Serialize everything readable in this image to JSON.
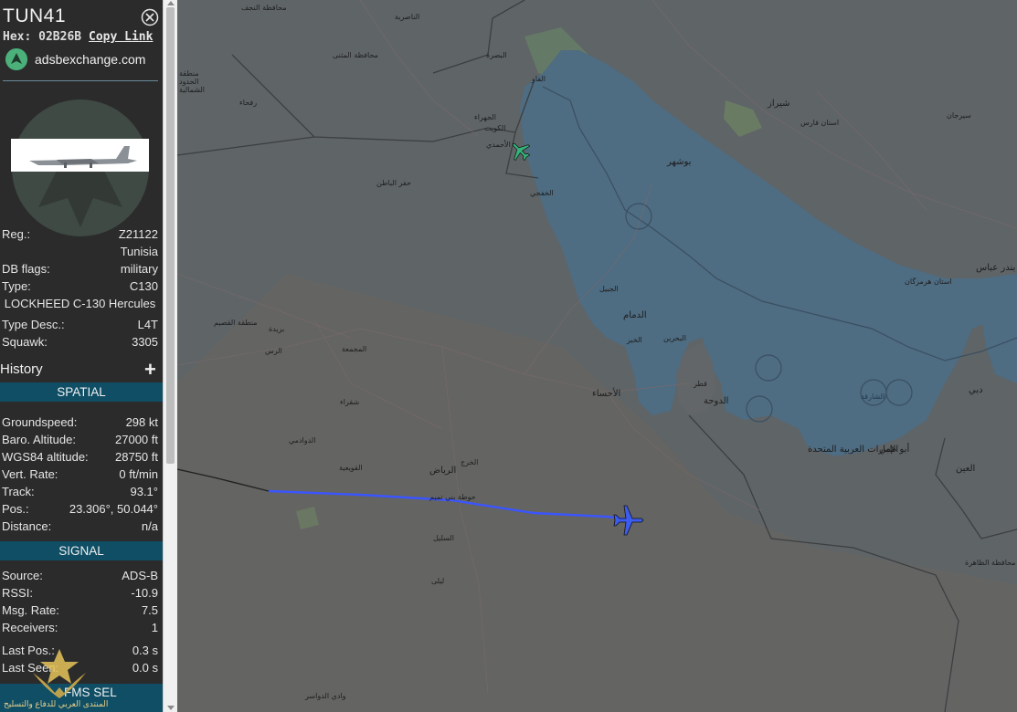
{
  "aircraft": {
    "callsign": "TUN41",
    "hex_label": "Hex:",
    "hex": "02B26B",
    "copy_link": "Copy Link",
    "site_link": "adsbexchange.com"
  },
  "details": [
    {
      "key": "Reg.:",
      "value": "Z21122"
    },
    {
      "key": "",
      "value": "Tunisia"
    },
    {
      "key": "DB flags:",
      "value": "military"
    },
    {
      "key": "Type:",
      "value": "C130"
    },
    {
      "key": "",
      "value": "LOCKHEED C-130 Hercules"
    },
    {
      "key": "Type Desc.:",
      "value": "L4T"
    },
    {
      "key": "Squawk:",
      "value": "3305"
    }
  ],
  "history": {
    "label": "History",
    "plus": "+"
  },
  "spatial": {
    "title": "SPATIAL",
    "rows": [
      {
        "key": "Groundspeed:",
        "value": "298 kt"
      },
      {
        "key": "Baro. Altitude:",
        "value": "27000 ft"
      },
      {
        "key": "WGS84 altitude:",
        "value": "28750 ft"
      },
      {
        "key": "Vert. Rate:",
        "value": "0 ft/min"
      },
      {
        "key": "Track:",
        "value": "93.1°"
      },
      {
        "key": "Pos.:",
        "value": "23.306°, 50.044°"
      },
      {
        "key": "Distance:",
        "value": "n/a"
      }
    ]
  },
  "signal": {
    "title": "SIGNAL",
    "rows": [
      {
        "key": "Source:",
        "value": "ADS-B"
      },
      {
        "key": "RSSI:",
        "value": "-10.9"
      },
      {
        "key": "Msg. Rate:",
        "value": "7.5"
      },
      {
        "key": "Receivers:",
        "value": "1"
      },
      {
        "key": "Last Pos.:",
        "value": "0.3 s"
      },
      {
        "key": "Last Seen:",
        "value": "0.0 s"
      }
    ]
  },
  "fms": {
    "title": "FMS SEL"
  },
  "watermark": {
    "text": "المنتدى العربي للدفاع والتسليح"
  },
  "map": {
    "labels": [
      {
        "text": "محافظة النجف"
      },
      {
        "text": "الناصرية"
      },
      {
        "text": "محافظة المثنى"
      },
      {
        "text": "البصرة"
      },
      {
        "text": "الفاو"
      },
      {
        "text": "الكويت"
      },
      {
        "text": "الجهراء"
      },
      {
        "text": "الأحمدي"
      },
      {
        "text": "الخفجي"
      },
      {
        "text": "حفر الباطن"
      },
      {
        "text": "منطقة الحدود الشمالية"
      },
      {
        "text": "رفحاء"
      },
      {
        "text": "بوشهر"
      },
      {
        "text": "شيراز"
      },
      {
        "text": "استان فارس"
      },
      {
        "text": "سيرجان"
      },
      {
        "text": "بندر عباس"
      },
      {
        "text": "استان هرمزگان"
      },
      {
        "text": "الجبيل"
      },
      {
        "text": "الدمام"
      },
      {
        "text": "الخبر"
      },
      {
        "text": "البحرين"
      },
      {
        "text": "الأحساء"
      },
      {
        "text": "الدوحة"
      },
      {
        "text": "قطر"
      },
      {
        "text": "الإمارات العربية المتحدة"
      },
      {
        "text": "أبو ظبي"
      },
      {
        "text": "دبي"
      },
      {
        "text": "العين"
      },
      {
        "text": "الرياض"
      },
      {
        "text": "منطقة القصيم"
      },
      {
        "text": "المجمعة"
      },
      {
        "text": "شقراء"
      },
      {
        "text": "الدوادمي"
      },
      {
        "text": "القويعية"
      },
      {
        "text": "حوطة بني تميم"
      },
      {
        "text": "السليل"
      },
      {
        "text": "وادي الدواسر"
      },
      {
        "text": "محافظة الظاهرة"
      },
      {
        "text": "الشارقة"
      },
      {
        "text": "الخرج"
      },
      {
        "text": "بريدة"
      },
      {
        "text": "الرس"
      },
      {
        "text": "ليلى"
      }
    ]
  },
  "colors": {
    "sidebar_bg": "#2b2b2b",
    "section_bar": "#0f4e65",
    "map_land": "#5f6467",
    "map_sea": "#4e6c82",
    "track_line": "#3a55ff",
    "selected_plane": "#3c5cf0",
    "other_plane": "#34b37a"
  }
}
